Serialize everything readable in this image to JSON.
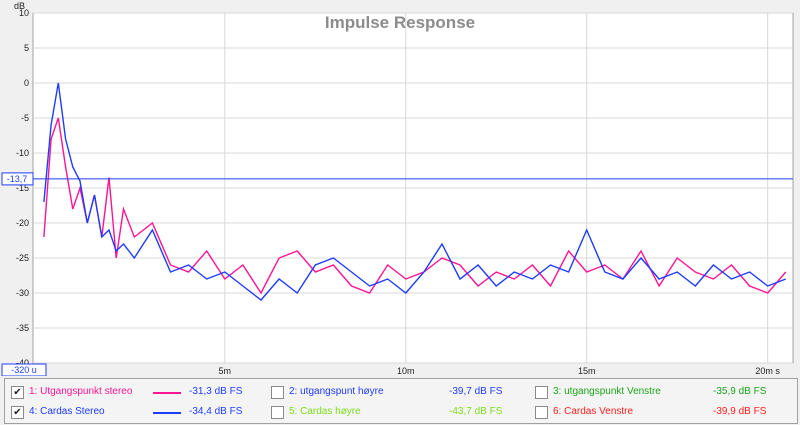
{
  "chart_data": {
    "type": "line",
    "title": "Impulse Response",
    "ylabel": "dB",
    "xunit": "s",
    "ylim": [
      -40,
      10
    ],
    "xlim": [
      -0.0003,
      0.0207
    ],
    "yticks": [
      10,
      5,
      0,
      -5,
      -10,
      -15,
      -20,
      -25,
      -30,
      -35,
      -40
    ],
    "ytick_labels": [
      "10",
      "5",
      "0",
      "-5",
      "-10",
      "-15",
      "-20",
      "-25",
      "-30",
      "-35",
      "-40"
    ],
    "xticks": [
      0.005,
      0.01,
      0.015,
      0.02
    ],
    "xtick_labels": [
      "5m",
      "10m",
      "15m",
      "20m s"
    ],
    "marker_y_label": "-13,7",
    "marker_x_label": "-320 u",
    "marker_y": -13.7,
    "grid": true,
    "series": [
      {
        "name": "1: Utgangspunkt stereo",
        "color": "#ff1493",
        "checked": true,
        "value_label": "-31,3 dB FS",
        "x": [
          0.0,
          0.0002,
          0.0004,
          0.0006,
          0.0008,
          0.001,
          0.0012,
          0.0014,
          0.0016,
          0.0018,
          0.002,
          0.0022,
          0.0025,
          0.003,
          0.0035,
          0.004,
          0.0045,
          0.005,
          0.0055,
          0.006,
          0.0065,
          0.007,
          0.0075,
          0.008,
          0.0085,
          0.009,
          0.0095,
          0.01,
          0.0105,
          0.011,
          0.0115,
          0.012,
          0.0125,
          0.013,
          0.0135,
          0.014,
          0.0145,
          0.015,
          0.0155,
          0.016,
          0.0165,
          0.017,
          0.0175,
          0.018,
          0.0185,
          0.019,
          0.0195,
          0.02,
          0.0205
        ],
        "y": [
          -22,
          -8,
          -5,
          -12,
          -18,
          -15,
          -20,
          -16,
          -22,
          -13.5,
          -25,
          -18,
          -22,
          -20,
          -26,
          -27,
          -24,
          -28,
          -26,
          -30,
          -25,
          -24,
          -27,
          -26,
          -29,
          -30,
          -26,
          -28,
          -27,
          -25,
          -26,
          -29,
          -27,
          -28,
          -26,
          -29,
          -24,
          -27,
          -26,
          -28,
          -24,
          -29,
          -25,
          -27,
          -28,
          -26,
          -29,
          -30,
          -27
        ]
      },
      {
        "name": "4: Cardas Stereo",
        "color": "#1e3cff",
        "checked": true,
        "value_label": "-34,4 dB FS",
        "x": [
          0.0,
          0.0002,
          0.0004,
          0.0006,
          0.0008,
          0.001,
          0.0012,
          0.0014,
          0.0016,
          0.0018,
          0.002,
          0.0022,
          0.0025,
          0.003,
          0.0035,
          0.004,
          0.0045,
          0.005,
          0.0055,
          0.006,
          0.0065,
          0.007,
          0.0075,
          0.008,
          0.0085,
          0.009,
          0.0095,
          0.01,
          0.0105,
          0.011,
          0.0115,
          0.012,
          0.0125,
          0.013,
          0.0135,
          0.014,
          0.0145,
          0.015,
          0.0155,
          0.016,
          0.0165,
          0.017,
          0.0175,
          0.018,
          0.0185,
          0.019,
          0.0195,
          0.02,
          0.0205
        ],
        "y": [
          -17,
          -6,
          0,
          -8,
          -12,
          -14,
          -20,
          -16,
          -22,
          -21,
          -24,
          -23,
          -25,
          -21,
          -27,
          -26,
          -28,
          -27,
          -29,
          -31,
          -28,
          -30,
          -26,
          -25,
          -27,
          -29,
          -28,
          -30,
          -27,
          -23,
          -28,
          -26,
          -29,
          -27,
          -28,
          -26,
          -27,
          -21,
          -27,
          -28,
          -25,
          -28,
          -27,
          -29,
          -26,
          -28,
          -27,
          -29,
          -28
        ]
      },
      {
        "name": "2: utgangspunt høyre",
        "color": "#1e3cff",
        "checked": false,
        "value_label": "-39,7 dB FS"
      },
      {
        "name": "5: Cardas høyre",
        "color": "#7ddc1f",
        "checked": false,
        "value_label": "-43,7 dB FS"
      },
      {
        "name": "3: utgangspunkt Venstre",
        "color": "#1aa51a",
        "checked": false,
        "value_label": "-35,9 dB FS"
      },
      {
        "name": "6: Cardas Venstre",
        "color": "#ff2020",
        "checked": false,
        "value_label": "-39,9 dB FS"
      }
    ]
  },
  "legend": {
    "check_mark": "✔",
    "items": [
      {
        "label": "1: Utgangspunkt stereo",
        "value": "-31,3 dB FS",
        "checked": "✔",
        "color": "#ff1493",
        "label_color": "#ff1493",
        "value_color": "#1e3cff",
        "show_line": true
      },
      {
        "label": "2: utgangspunt høyre",
        "value": "-39,7 dB FS",
        "checked": "",
        "color": "#1e3cff",
        "label_color": "#1e3cff",
        "value_color": "#1e3cff",
        "show_line": false
      },
      {
        "label": "3: utgangspunkt Venstre",
        "value": "-35,9 dB FS",
        "checked": "",
        "color": "#1aa51a",
        "label_color": "#1aa51a",
        "value_color": "#1aa51a",
        "show_line": false
      },
      {
        "label": "4: Cardas Stereo",
        "value": "-34,4 dB FS",
        "checked": "✔",
        "color": "#1e3cff",
        "label_color": "#1e3cff",
        "value_color": "#1e3cff",
        "show_line": true
      },
      {
        "label": "5: Cardas høyre",
        "value": "-43,7 dB FS",
        "checked": "",
        "color": "#7ddc1f",
        "label_color": "#7ddc1f",
        "value_color": "#7ddc1f",
        "show_line": false
      },
      {
        "label": "6: Cardas Venstre",
        "value": "-39,9 dB FS",
        "checked": "",
        "color": "#ff2020",
        "label_color": "#ff2020",
        "value_color": "#ff2020",
        "show_line": false
      }
    ]
  }
}
